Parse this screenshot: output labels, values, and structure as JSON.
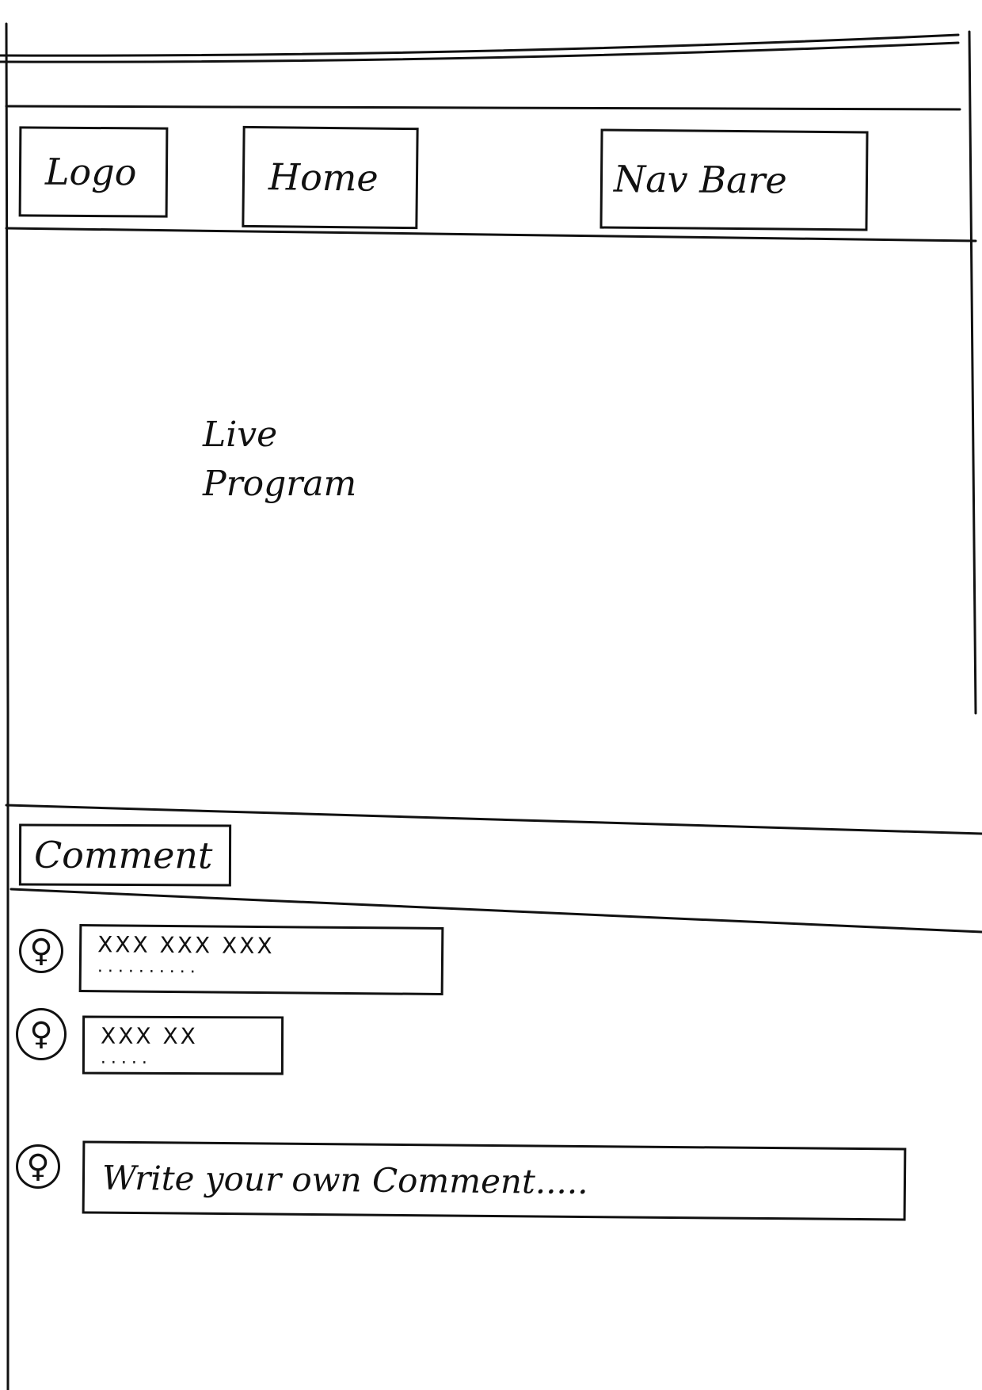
{
  "header": {
    "logo_label": "Logo",
    "home_label": "Home",
    "navbar_label": "Nav Bare"
  },
  "main": {
    "live_line1": "Live",
    "live_line2": "Program"
  },
  "comments": {
    "section_label": "Comment",
    "items": [
      {
        "text": "XXX XXX XXX",
        "dots": ".........."
      },
      {
        "text": "XXX XX",
        "dots": "....."
      }
    ],
    "input_placeholder": "Write your own Comment....."
  },
  "icons": {
    "avatar": "female-user-icon"
  }
}
